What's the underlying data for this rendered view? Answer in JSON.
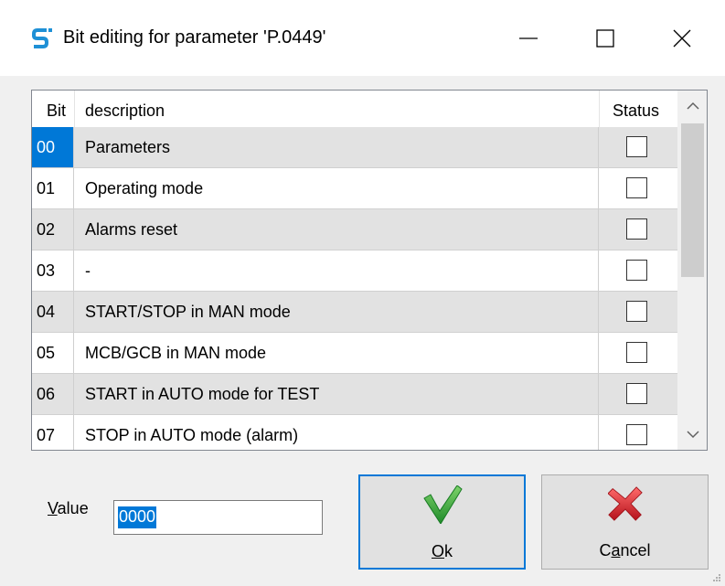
{
  "window": {
    "title": "Bit editing for parameter 'P.0449'"
  },
  "table": {
    "headers": {
      "bit": "Bit",
      "description": "description",
      "status": "Status"
    },
    "rows": [
      {
        "bit": "00",
        "description": "Parameters",
        "status": false
      },
      {
        "bit": "01",
        "description": "Operating mode",
        "status": false
      },
      {
        "bit": "02",
        "description": "Alarms reset",
        "status": false
      },
      {
        "bit": "03",
        "description": "-",
        "status": false
      },
      {
        "bit": "04",
        "description": "START/STOP in MAN mode",
        "status": false
      },
      {
        "bit": "05",
        "description": "MCB/GCB in MAN mode",
        "status": false
      },
      {
        "bit": "06",
        "description": "START in AUTO mode for TEST",
        "status": false
      },
      {
        "bit": "07",
        "description": "STOP in AUTO mode (alarm)",
        "status": false
      }
    ],
    "selected_row": "00"
  },
  "value": {
    "label_mnemonic": "V",
    "label_rest": "alue",
    "current": "0000"
  },
  "buttons": {
    "ok_mnemonic": "O",
    "ok_rest": "k",
    "cancel_prefix": "C",
    "cancel_mnemonic": "a",
    "cancel_rest": "ncel"
  },
  "icons": {
    "app": "app-s-icon",
    "ok": "checkmark-icon",
    "cancel": "red-x-icon"
  },
  "colors": {
    "selection": "#0078d7",
    "ok_green": "#2ea043",
    "cancel_red": "#d9232d"
  }
}
